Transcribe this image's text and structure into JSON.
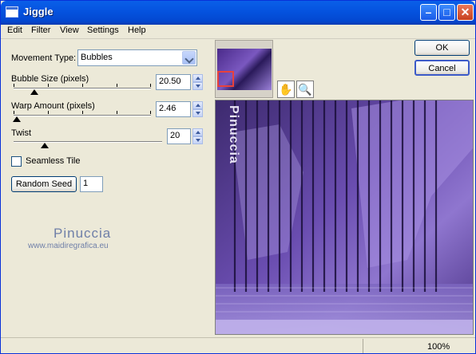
{
  "window": {
    "title": "Jiggle"
  },
  "menu": [
    "Edit",
    "Filter",
    "View",
    "Settings",
    "Help"
  ],
  "movement_type": {
    "label": "Movement Type:",
    "value": "Bubbles"
  },
  "bubble_size": {
    "label": "Bubble Size (pixels)",
    "value": "20.50",
    "level": 0.18
  },
  "warp_amount": {
    "label": "Warp Amount (pixels)",
    "value": "2.46",
    "level": 0.04
  },
  "twist": {
    "label": "Twist",
    "value": "20",
    "level": 0.2
  },
  "seamless": {
    "label": "Seamless Tile",
    "checked": false
  },
  "random_seed": {
    "button": "Random Seed",
    "value": "1"
  },
  "watermark": {
    "name": "Pinuccia",
    "url": "www.maidiregrafica.eu"
  },
  "buttons": {
    "ok": "OK",
    "cancel": "Cancel"
  },
  "preview_text": "Pinuccia",
  "status": {
    "zoom": "100%"
  },
  "colors": {
    "accent": "#0a5fe8",
    "preview": "#5a3d99"
  }
}
